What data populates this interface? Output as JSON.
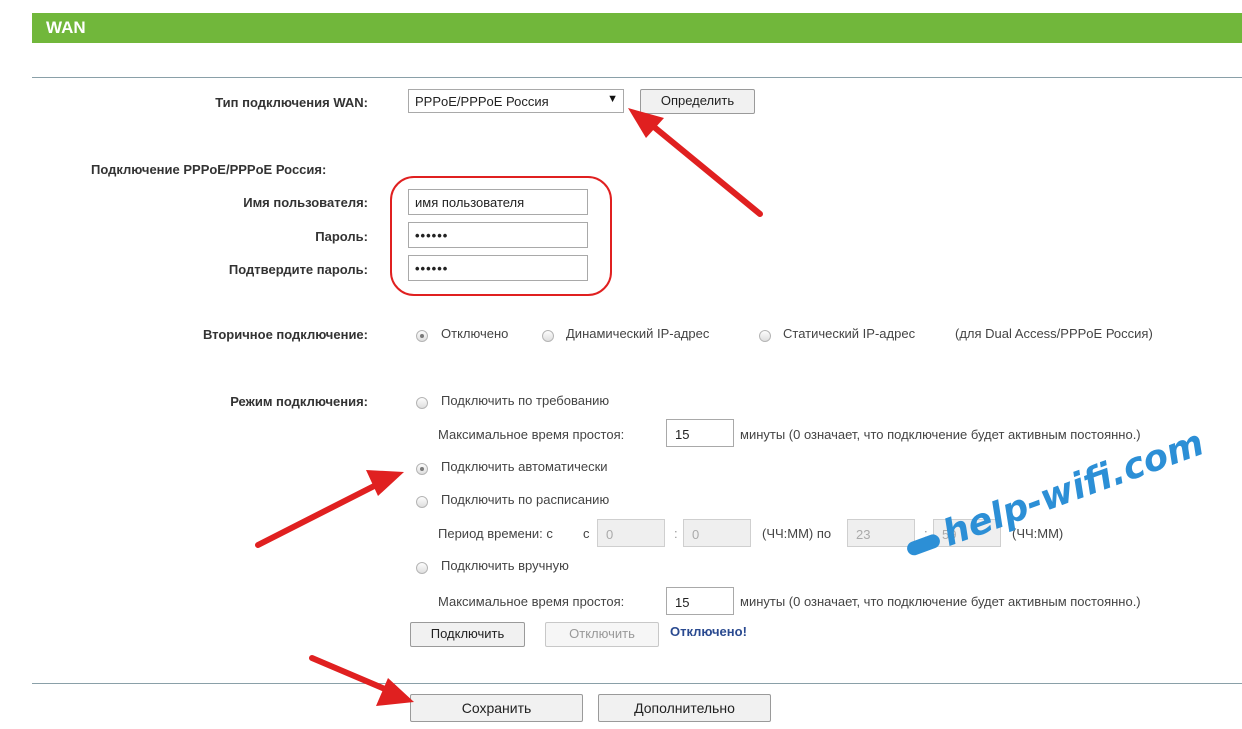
{
  "header": {
    "title": "WAN"
  },
  "wan_type": {
    "label": "Тип подключения WAN:",
    "selected": "PPPoE/PPPoE Россия",
    "detect_button": "Определить"
  },
  "pppoe": {
    "section_label": "Подключение PPPoE/PPPoE Россия:",
    "username_label": "Имя пользователя:",
    "username_value": "имя пользователя",
    "password_label": "Пароль:",
    "password_value": "••••••",
    "confirm_label": "Подтвердите пароль:",
    "confirm_value": "••••••"
  },
  "secondary": {
    "label": "Вторичное подключение:",
    "options": [
      "Отключено",
      "Динамический IP-адрес",
      "Статический IP-адрес"
    ],
    "selected_index": 0,
    "note": "(для Dual Access/PPPoE Россия)"
  },
  "mode": {
    "label": "Режим подключения:",
    "on_demand": "Подключить по требованию",
    "idle_label": "Максимальное время простоя:",
    "idle_value_1": "15",
    "idle_note": "минуты (0 означает, что подключение будет активным постоянно.)",
    "auto": "Подключить автоматически",
    "schedule": "Подключить по расписанию",
    "period_label": "Период времени: с",
    "period_c": "с",
    "from_h": "0",
    "from_m": "0",
    "hhmm": "(ЧЧ:ММ) по",
    "to_h": "23",
    "to_m": "59",
    "hhmm2": "(ЧЧ:ММ)",
    "manual": "Подключить вручную",
    "idle_value_2": "15",
    "selected": "auto"
  },
  "actions": {
    "connect": "Подключить",
    "disconnect": "Отключить",
    "status": "Отключено!",
    "save": "Сохранить",
    "advanced": "Дополнительно"
  },
  "watermark": "help-wifi.com",
  "colors": {
    "header": "#71b73b",
    "arrow": "#e02020",
    "status": "#2a4a90",
    "watermark": "#2c8fd6"
  }
}
